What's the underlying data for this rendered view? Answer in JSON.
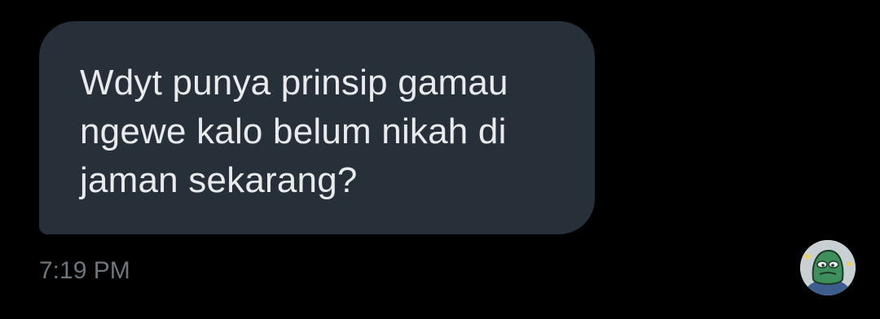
{
  "message": {
    "lines": [
      "Wdyt punya prinsip gamau",
      "ngewe kalo belum nikah di",
      "jaman sekarang?"
    ],
    "timestamp": "7:19 PM"
  },
  "avatar": {
    "icon": "green-cartoon-avatar-icon"
  },
  "colors": {
    "background": "#000000",
    "bubble": "#273038",
    "text": "#e8eaec",
    "timestamp": "#6e767d"
  }
}
